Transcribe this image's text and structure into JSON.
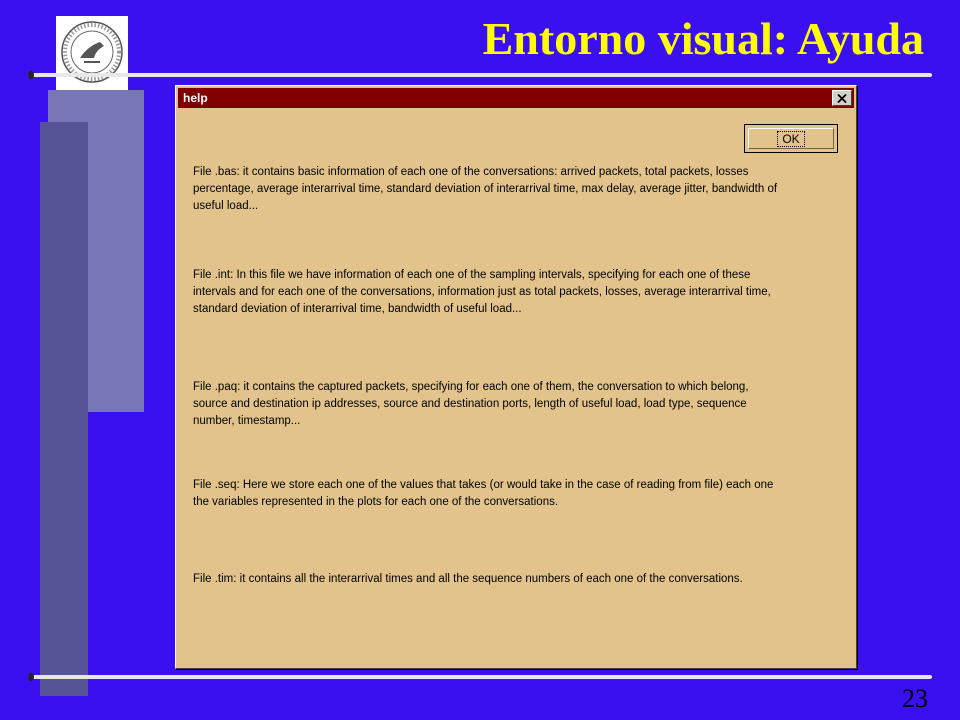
{
  "slide": {
    "title": "Entorno visual: Ayuda",
    "page_number": "23"
  },
  "logo": {
    "icon": "university-seal-icon",
    "seal_text": "UNIVERSITAS OVETENSIS"
  },
  "help_window": {
    "title": "help",
    "close_icon": "close-icon",
    "ok_label": "OK",
    "paragraphs": [
      "File .bas: it contains basic information of each one of the conversations: arrived packets, total packets, losses percentage, average interarrival time, standard deviation of interarrival time, max delay, average jitter, bandwidth of useful load...",
      "File .int: In this file we have information of each one of the sampling intervals, specifying for each one of these intervals and for each one of the conversations, information just as total packets, losses, average interarrival time, standard deviation of interarrival time, bandwidth of useful load...",
      "File .paq: it contains the captured packets, specifying for each one of them, the conversation to which belong, source and destination ip addresses, source and destination ports, length of useful load, load type, sequence number, timestamp...",
      "File .seq: Here we store each one of the values that takes (or would take in the case of reading from file) each one the variables represented in the plots for each one of the conversations.",
      "File .tim: it contains all the interarrival times and all the sequence numbers of each one of the conversations."
    ]
  },
  "colors": {
    "background": "#3a10f0",
    "title": "#ffff00",
    "window_body": "#e2c38c",
    "titlebar": "#800000"
  }
}
